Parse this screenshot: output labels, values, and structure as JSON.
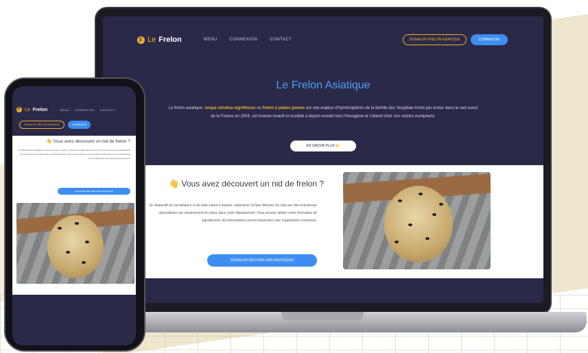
{
  "brand": {
    "logo_prefix": "Le",
    "logo_name": "Frelon",
    "logo_glyph": "F"
  },
  "nav": {
    "items": [
      {
        "label": "MENU"
      },
      {
        "label": "CONNEXION"
      },
      {
        "label": "CONTACT"
      }
    ],
    "report_label": "SIGNALER FRELON ASIATIQUE",
    "login_label": "CONNEXION"
  },
  "hero": {
    "title": "Le Frelon Asiatique",
    "text_1": "Le frelon asiatique, ",
    "highlight_1": "vespa velutina nigrithorax",
    "text_2": " ou ",
    "highlight_2": "frelon à pattes jaunes",
    "text_3": " est une espèce d'hyménoptères de la famille des Vespidae Arrivé par erreur dans le sud-ouest de la France en 2004, cet insecte invasif et nuisible a depuis envahi tout l'Hexagone et s'étend chez nos voisins européens.",
    "more_label": "EN SAVOIR PLUS 👉"
  },
  "section": {
    "title": "👋 Vous avez découvert un nid de frelon ?",
    "text": "Un dispositif de surveillance et de lutte visant à repérer, répertorier et faire détruire les nids par des entreprises spécialisées est certainement en place dans votre département. Vous pouvez utiliser notre formulaire de signalement, les informations seront transmises aux organismes concernés.",
    "report_label": "SIGNALER DES FRELONS ASIATIQUES"
  },
  "colors": {
    "navy": "#2b2948",
    "accent_yellow": "#f0b32e",
    "accent_blue": "#3d8ef0",
    "title_blue": "#4aa0f5"
  },
  "icons": [
    "hornet-logo-icon",
    "waving-hand-icon",
    "pointing-hand-icon"
  ]
}
